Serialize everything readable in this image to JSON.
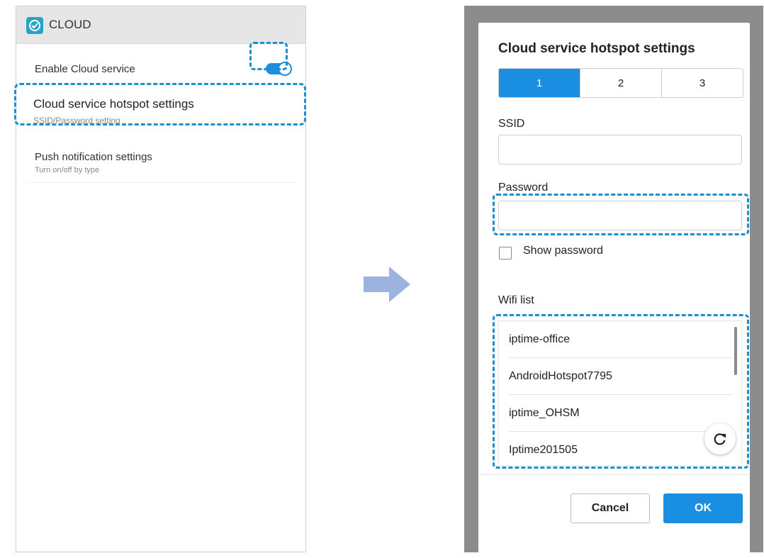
{
  "left": {
    "app_title": "CLOUD",
    "settings": {
      "enable_label": "Enable Cloud service",
      "enable_on": true,
      "hotspot_label": "Cloud service hotspot settings",
      "hotspot_sub": "SSID/Password setting",
      "push_label": "Push notification settings",
      "push_sub": "Turn on/off by type"
    }
  },
  "dialog": {
    "title": "Cloud service hotspot settings",
    "tabs": [
      "1",
      "2",
      "3"
    ],
    "selected_tab": "1",
    "ssid_label": "SSID",
    "ssid_value": "",
    "password_label": "Password",
    "password_value": "",
    "show_password_label": "Show password",
    "show_password_checked": false,
    "wifi_list_label": "Wifi list",
    "wifi_list": [
      "iptime-office",
      "AndroidHotspot7795",
      "iptime_OHSM",
      "Iptime201505"
    ],
    "cancel_label": "Cancel",
    "ok_label": "OK"
  },
  "colors": {
    "accent": "#1a8ee0",
    "highlight": "#1b8fd0",
    "arrow": "#9bb3de",
    "overlay": "#8c8c8c"
  },
  "icons": [
    "cloud-app-icon",
    "refresh-icon",
    "right-arrow-icon"
  ]
}
